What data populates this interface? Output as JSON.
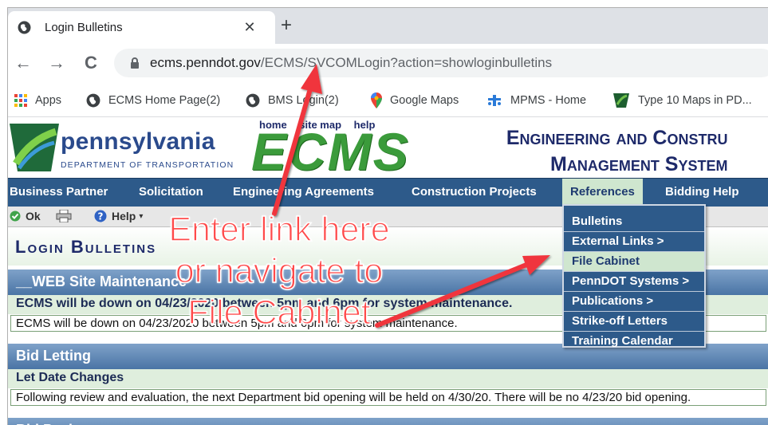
{
  "browser": {
    "tab_title": "Login Bulletins",
    "tab_close": "✕",
    "new_tab": "+",
    "back": "←",
    "forward": "→",
    "reload": "C",
    "url_domain": "ecms.penndot.gov",
    "url_path": "/ECMS/SVCOMLogin?action=showloginbulletins"
  },
  "bookmarks": [
    {
      "label": "Apps",
      "icon": "apps-grid-icon"
    },
    {
      "label": "ECMS Home Page(2)",
      "icon": "globe-icon"
    },
    {
      "label": "BMS Login(2)",
      "icon": "globe-icon"
    },
    {
      "label": "Google Maps",
      "icon": "map-pin-icon"
    },
    {
      "label": "MPMS - Home",
      "icon": "mpms-icon"
    },
    {
      "label": "Type 10 Maps in PD...",
      "icon": "keystone-icon"
    }
  ],
  "header": {
    "state_name": "pennsylvania",
    "department": "DEPARTMENT OF TRANSPORTATION",
    "logo_text": "ECMS",
    "top_links": [
      "home",
      "site map",
      "help"
    ],
    "system_title_line1": "Engineering and Constru",
    "system_title_line2": "Management System"
  },
  "menu": [
    "Business Partner",
    "Solicitation",
    "Engineering Agreements",
    "Construction Projects",
    "References",
    "Bidding Help"
  ],
  "dropdown": [
    "Bulletins",
    "External Links >",
    "File Cabinet",
    "PennDOT Systems >",
    "Publications >",
    "Strike-off Letters",
    "Training Calendar"
  ],
  "actions": {
    "ok": "Ok",
    "help": "Help"
  },
  "page": {
    "title": "Login Bulletins",
    "sections": [
      {
        "band": "__WEB Site Maintenance",
        "subhead": "ECMS will be down on 04/23/2020 between 5pm and 6pm for system maintenance.",
        "body": "ECMS will be down on 04/23/2020 between 5pm and 6pm for system maintenance."
      },
      {
        "band": "Bid Letting",
        "subhead": "Let Date Changes",
        "body": "Following review and evaluation, the next Department bid opening will be held on 4/30/20.  There will be no 4/23/20 bid opening."
      },
      {
        "band": "Bid Package"
      }
    ]
  },
  "annotation": {
    "line1": "Enter link here",
    "line2": "or navigate to",
    "line3": "File Cabinet",
    "color": "#ff4a4a"
  },
  "colors": {
    "menu_bg": "#2d5a8a",
    "menu_active": "#cfe6cf",
    "band": "#5f86b3",
    "logo_green": "#3b9b3b"
  }
}
